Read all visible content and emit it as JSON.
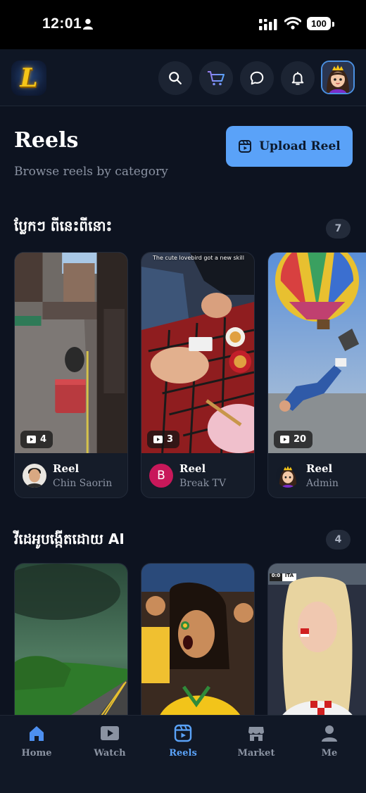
{
  "status": {
    "time": "12:01",
    "battery": "100"
  },
  "header": {
    "logo_letter": "L"
  },
  "page": {
    "title": "Reels",
    "subtitle": "Browse reels by category",
    "upload_label": "Upload Reel"
  },
  "sections": [
    {
      "title": "ប្លែកៗ ពីនេះពីនោះ",
      "count": "7",
      "reels": [
        {
          "views": "4",
          "title": "Reel",
          "author": "Chin Saorin"
        },
        {
          "views": "3",
          "title": "Reel",
          "author": "Break TV",
          "avatar_letter": "B",
          "caption": "The cute lovebird got a new skill"
        },
        {
          "views": "20",
          "title": "Reel",
          "author": "Admin"
        }
      ]
    },
    {
      "title": "វីដេអូបង្កើតដោយ AI",
      "count": "4",
      "reels": [
        {},
        {},
        {
          "score": "0:0",
          "team": "ITA"
        }
      ]
    }
  ],
  "tabs": [
    {
      "label": "Home",
      "icon": "home-icon"
    },
    {
      "label": "Watch",
      "icon": "play-icon"
    },
    {
      "label": "Reels",
      "icon": "reels-icon"
    },
    {
      "label": "Market",
      "icon": "store-icon"
    },
    {
      "label": "Me",
      "icon": "person-icon"
    }
  ],
  "colors": {
    "accent": "#5aa2f8",
    "background": "#0d1320",
    "card": "#151c29"
  }
}
